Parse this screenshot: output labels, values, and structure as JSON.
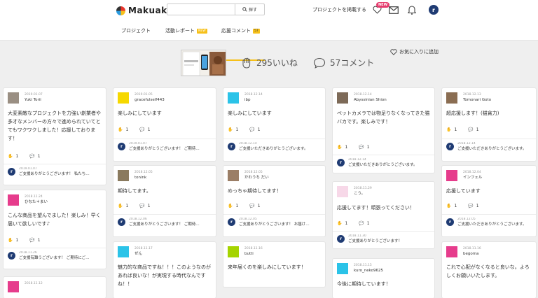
{
  "header": {
    "logo_text": "Makuake",
    "search_placeholder": "",
    "search_button": "探す",
    "post_project": "プロジェクトを掲載する",
    "new_badge": "NEW",
    "avatar_letter": "r"
  },
  "tabs": {
    "project": "プロジェクト",
    "activity": "活動レポート",
    "activity_tag": "NEW",
    "comments": "応援コメント",
    "comments_tag": "57",
    "favorite": "お気に入りに追加"
  },
  "stats": {
    "likes": "295いいね",
    "comments": "57コメント"
  },
  "colors": {
    "accent": "#f6c01a",
    "new_badge": "#e63c6e",
    "activity_tag": "#f6c01a",
    "reply_avatar": "#1f3b73"
  },
  "cards": [
    {
      "date": "2019.01.07",
      "name": "Yuki Torii",
      "body": "大変素敵なプロジェクトを力強い創業者や多才なメンバーの方々で進められていてとてもワクワクしました！応援しております！",
      "likes": "1",
      "comments": "1",
      "reply_date": "2019.01.07",
      "reply": "ご支援ありがとうございます！ 私たち…"
    },
    {
      "date": "2019.01.05",
      "name": "gracefulself443",
      "body": "楽しみにしています",
      "likes": "1",
      "comments": "1",
      "reply_date": "2019.01.07",
      "reply": "ご支援ありがとうございます！ ご期待…"
    },
    {
      "date": "2018.12.14",
      "name": "ibp",
      "body": "楽しみにしています",
      "likes": "1",
      "comments": "1",
      "reply_date": "2018.12.14",
      "reply": "ご支援いただきありがとうございます。"
    },
    {
      "date": "2018.12.14",
      "name": "Abyssinian Shion",
      "body": "ペットカメラでは物足りなくなってきた猫バカです。楽しみです！",
      "likes": "1",
      "comments": "1",
      "reply_date": "2018.12.14",
      "reply": "ご支援いただきありがとうございます。"
    },
    {
      "date": "2018.12.13",
      "name": "Tomonari Goto",
      "body": "超応援します！(猫貪力)",
      "likes": "1",
      "comments": "1",
      "reply_date": "2018.12.14",
      "reply": "ご支援いただきありがとうございます。"
    },
    {
      "date": "2018.11.24",
      "name": "ひなた＊まい",
      "body": "こんな商品を望んでました！楽しみ！早く届いて欲しいです♪",
      "likes": "1",
      "comments": "1",
      "reply_date": "2018.11.26",
      "reply": "ご支援有難うございます！ ご期待にご…"
    },
    {
      "date": "2018.12.05",
      "name": "tonink",
      "body": "期待してます。",
      "likes": "1",
      "comments": "1",
      "reply_date": "2018.12.06",
      "reply": "ご支援ありがとうございます！ ご期待…"
    },
    {
      "date": "2018.12.05",
      "name": "かわうち だい",
      "body": "めっちゃ期待してます！",
      "likes": "1",
      "comments": "1",
      "reply_date": "2018.12.05",
      "reply": "ご支援ありがとうございます！ お届け…"
    },
    {
      "date": "2018.11.29",
      "name": "こう。",
      "body": "応援してます！頑張ってください！",
      "likes": "1",
      "comments": "1",
      "reply_date": "2018.11.30",
      "reply": "ご支援ありがとうございます！"
    },
    {
      "date": "2018.12.04",
      "name": "インフェル",
      "body": "応援しています",
      "likes": "1",
      "comments": "1",
      "reply_date": "2018.12.05",
      "reply": "ご支援いただきありがとうございます。"
    },
    {
      "date": "2018.11.17",
      "name": "ぜん",
      "body": "魅力的な商品ですね！！！このようなのがあれば良いな！が実現する時代なんですね！！",
      "likes": "",
      "comments": "",
      "reply_date": "",
      "reply": ""
    },
    {
      "date": "2018.11.16",
      "name": "butti",
      "body": "来年届くのを楽しみにしています！",
      "likes": "1",
      "comments": "1",
      "reply_date": "2018.11.16",
      "reply": "ご支援ありがとうございます！ お届け…"
    },
    {
      "date": "2018.11.15",
      "name": "kuro_neko9625",
      "body": "今後に期待しています！",
      "likes": "",
      "comments": "",
      "reply_date": "",
      "reply": ""
    },
    {
      "date": "2018.11.16",
      "name": "begoma",
      "body": "これで心配がなくなると良いな。よろしくお願いいたします。",
      "likes": "",
      "comments": "",
      "reply_date": "",
      "reply": ""
    },
    {
      "date": "2018.11.12",
      "name": "",
      "body": "",
      "likes": "",
      "comments": "",
      "reply_date": "",
      "reply": ""
    }
  ]
}
